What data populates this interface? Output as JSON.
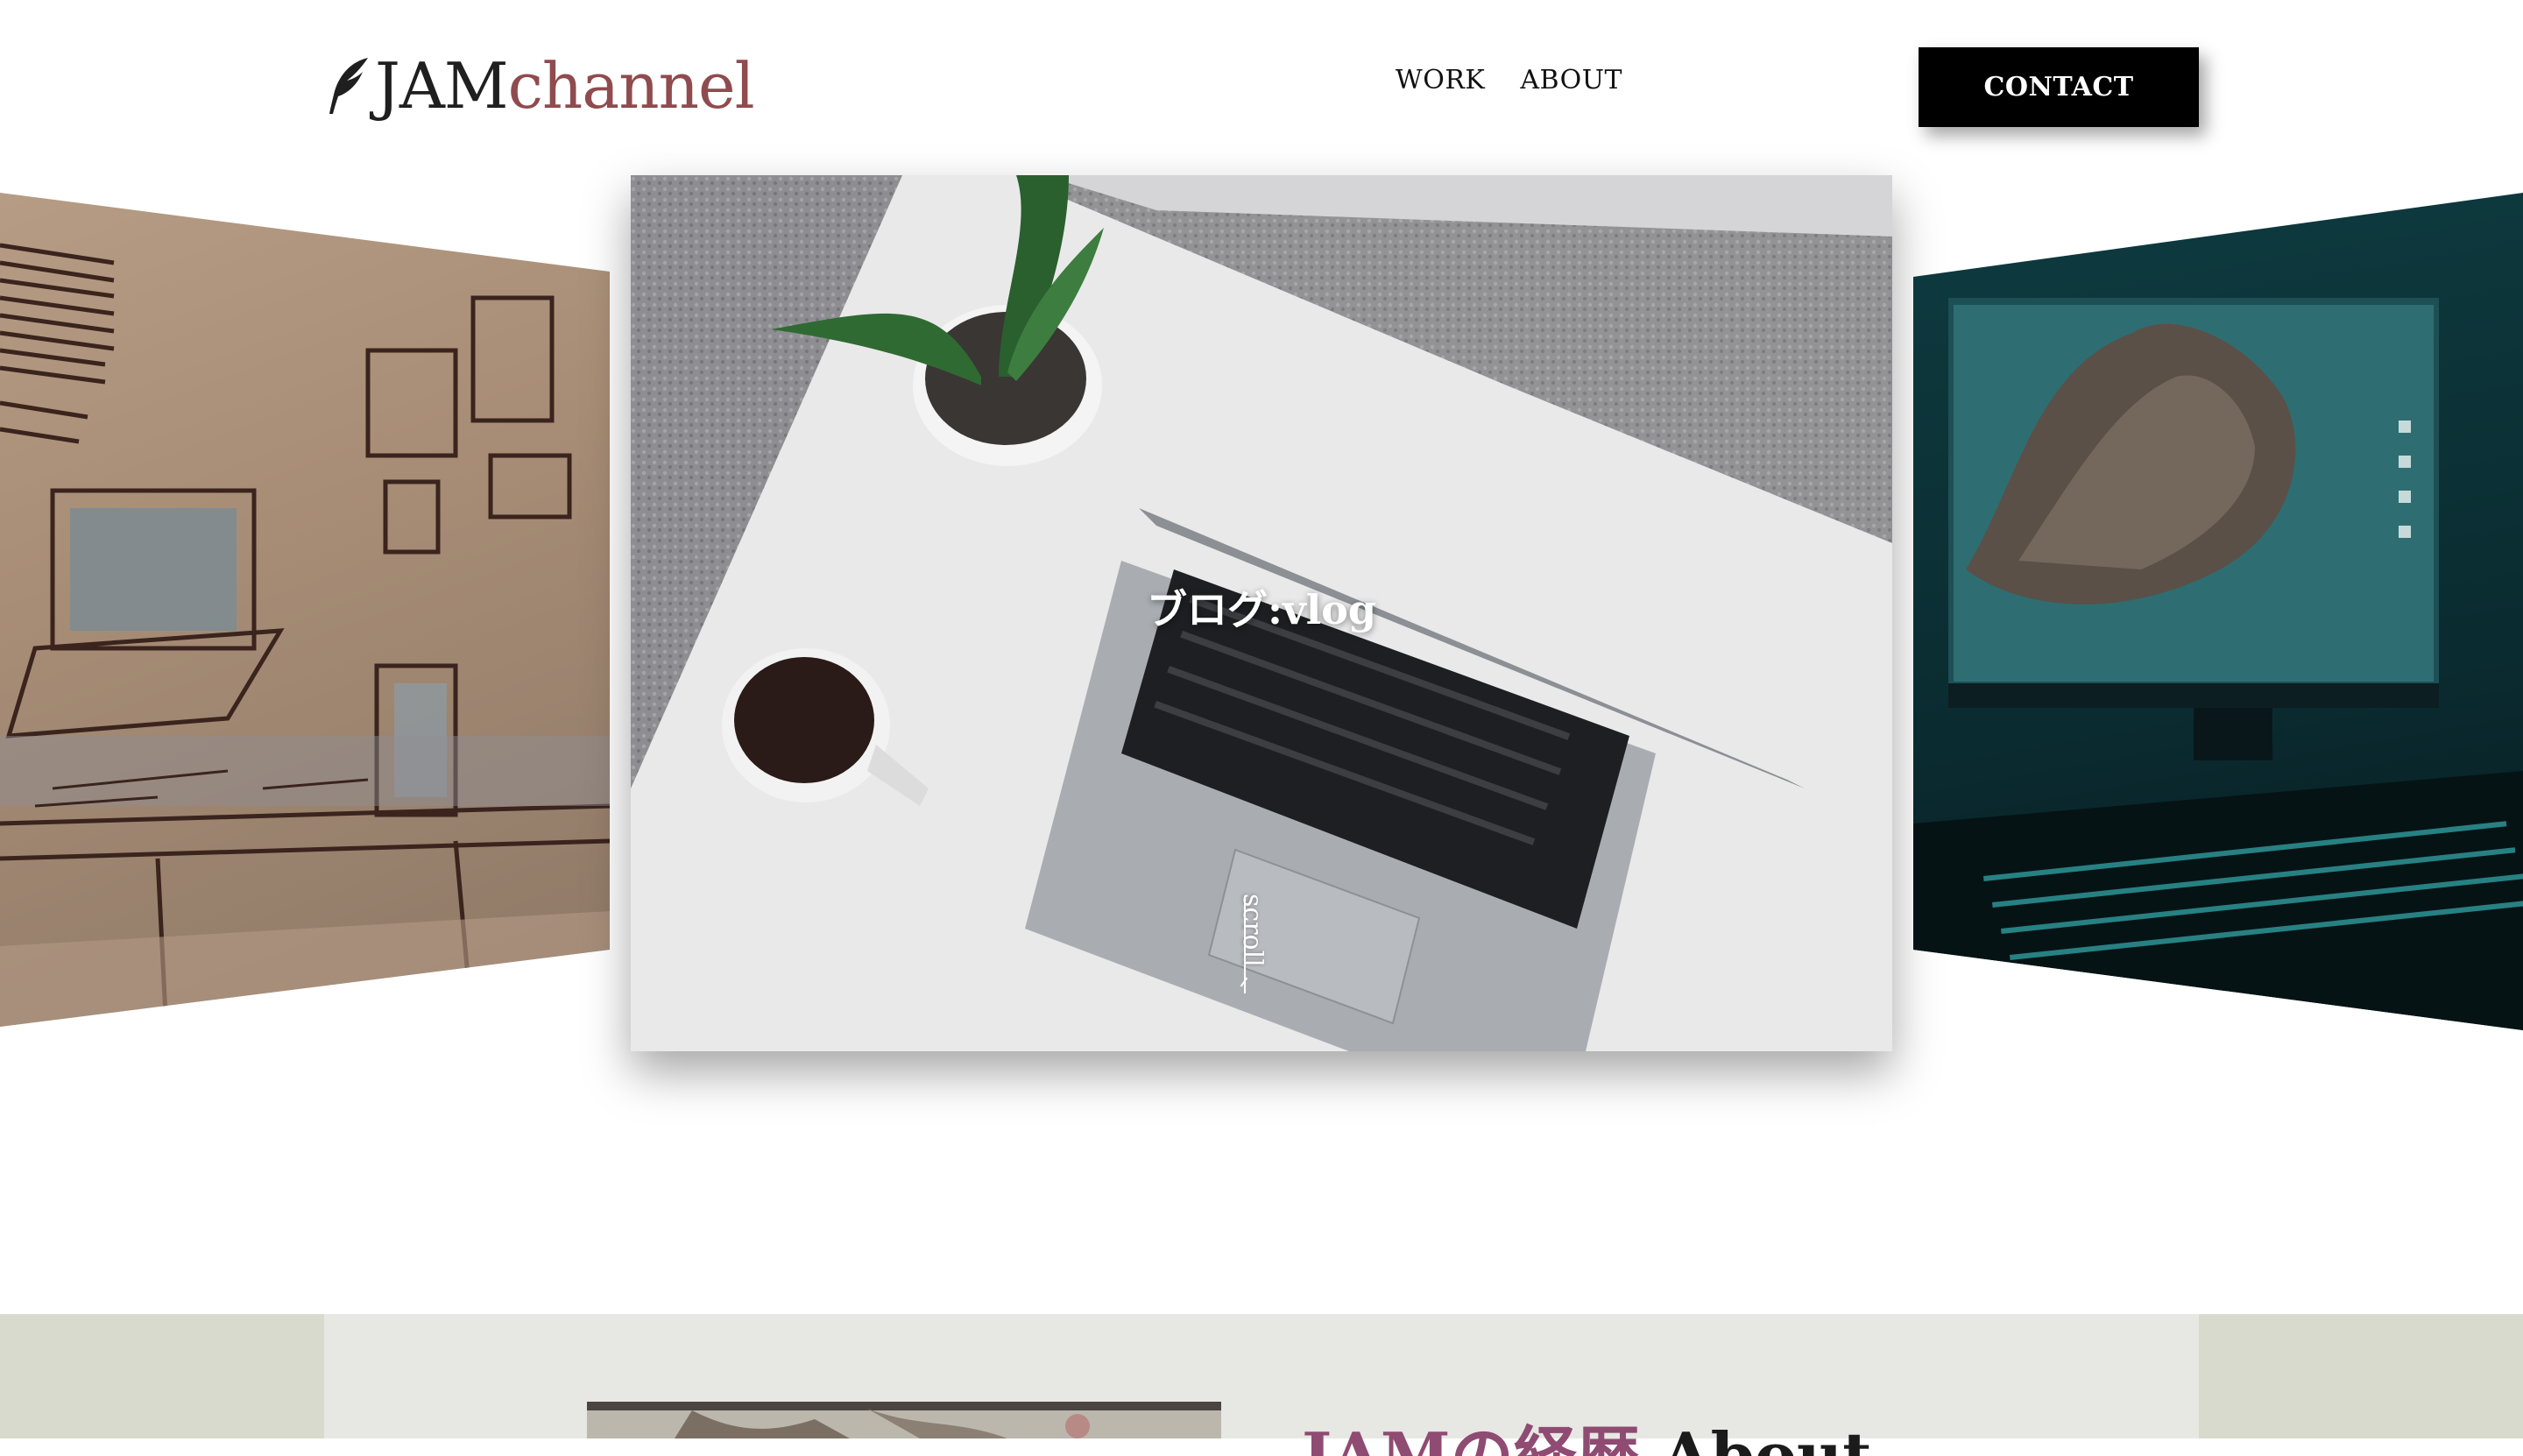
{
  "header": {
    "logo": {
      "part1": "JAM",
      "part2": "channel",
      "icon": "quill-icon"
    },
    "nav": [
      {
        "label": "WORK"
      },
      {
        "label": "ABOUT"
      }
    ],
    "contact_label": "CONTACT"
  },
  "carousel": {
    "active_slide_title": "ブログ:vlog",
    "slides": [
      {
        "position": "left",
        "image": "desk-workspace-illustration"
      },
      {
        "position": "center",
        "image": "laptop-coffee-plant-desk"
      },
      {
        "position": "right",
        "image": "desktop-monitor-island-wallpaper"
      }
    ],
    "scroll_label": "scroll"
  },
  "about": {
    "heading_jp": "JAMの経歴",
    "heading_en": "About"
  },
  "colors": {
    "brand_accent": "#8f4b4e",
    "about_accent": "#8f4b72",
    "about_band": "#d8dacd",
    "about_inner": "#e7e8e3"
  }
}
